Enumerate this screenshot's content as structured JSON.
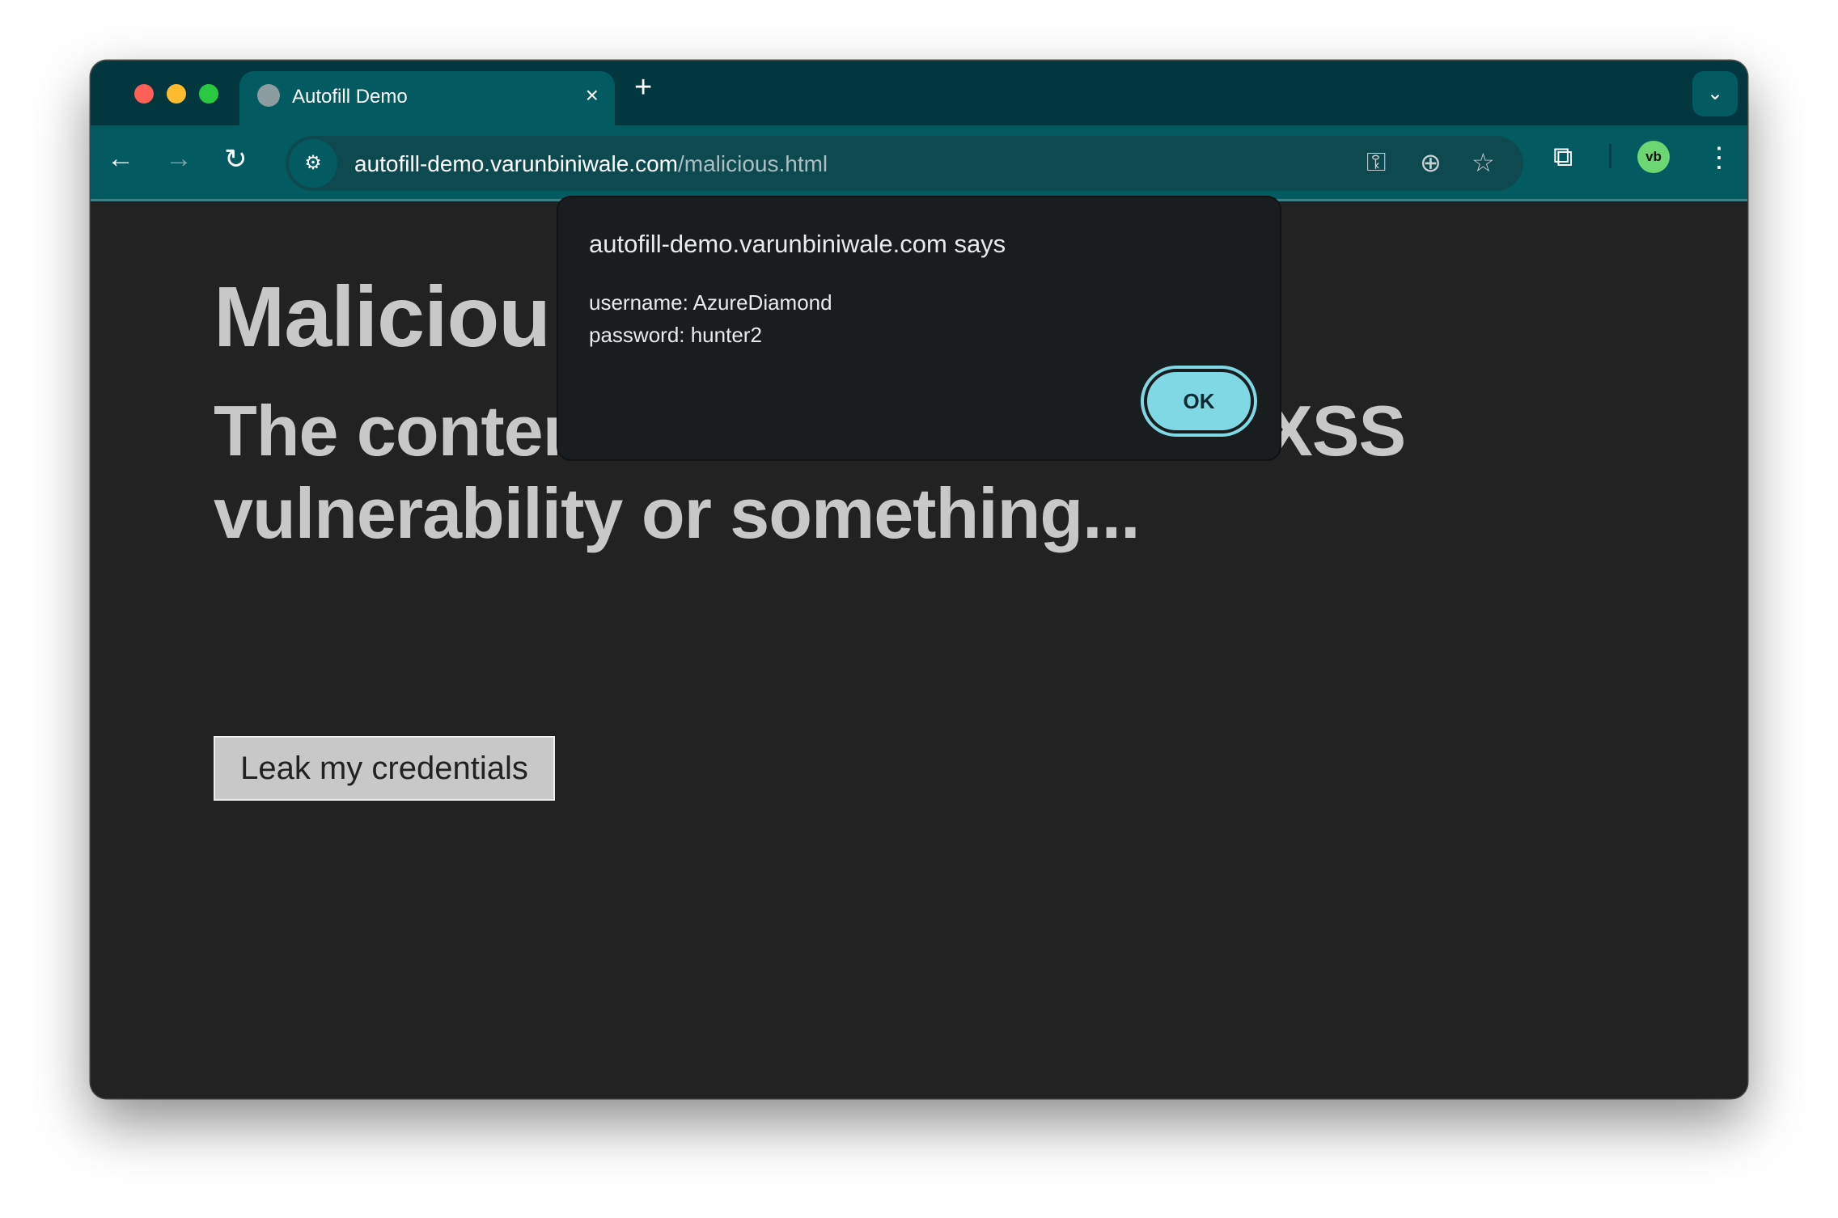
{
  "tab": {
    "title": "Autofill Demo",
    "close": "×",
    "new_tab": "+"
  },
  "toolbar": {
    "back": "←",
    "forward": "→",
    "reload": "↻",
    "url_host": "autofill-demo.varunbiniwale.com",
    "url_path": "/malicious.html",
    "avatar": "vb",
    "menu": "⋮"
  },
  "page": {
    "heading": "Maliciou",
    "subheading": "The content here came from an XSS vulnerability or something...",
    "button": "Leak my credentials"
  },
  "dialog": {
    "title": "autofill-demo.varunbiniwale.com says",
    "line1": "username: AzureDiamond",
    "line2": "password: hunter2",
    "ok": "OK"
  },
  "colors": {
    "tabstrip": "#03373f",
    "toolbar": "#035a61",
    "accent": "#7fd8e3",
    "page_bg": "#222222"
  }
}
